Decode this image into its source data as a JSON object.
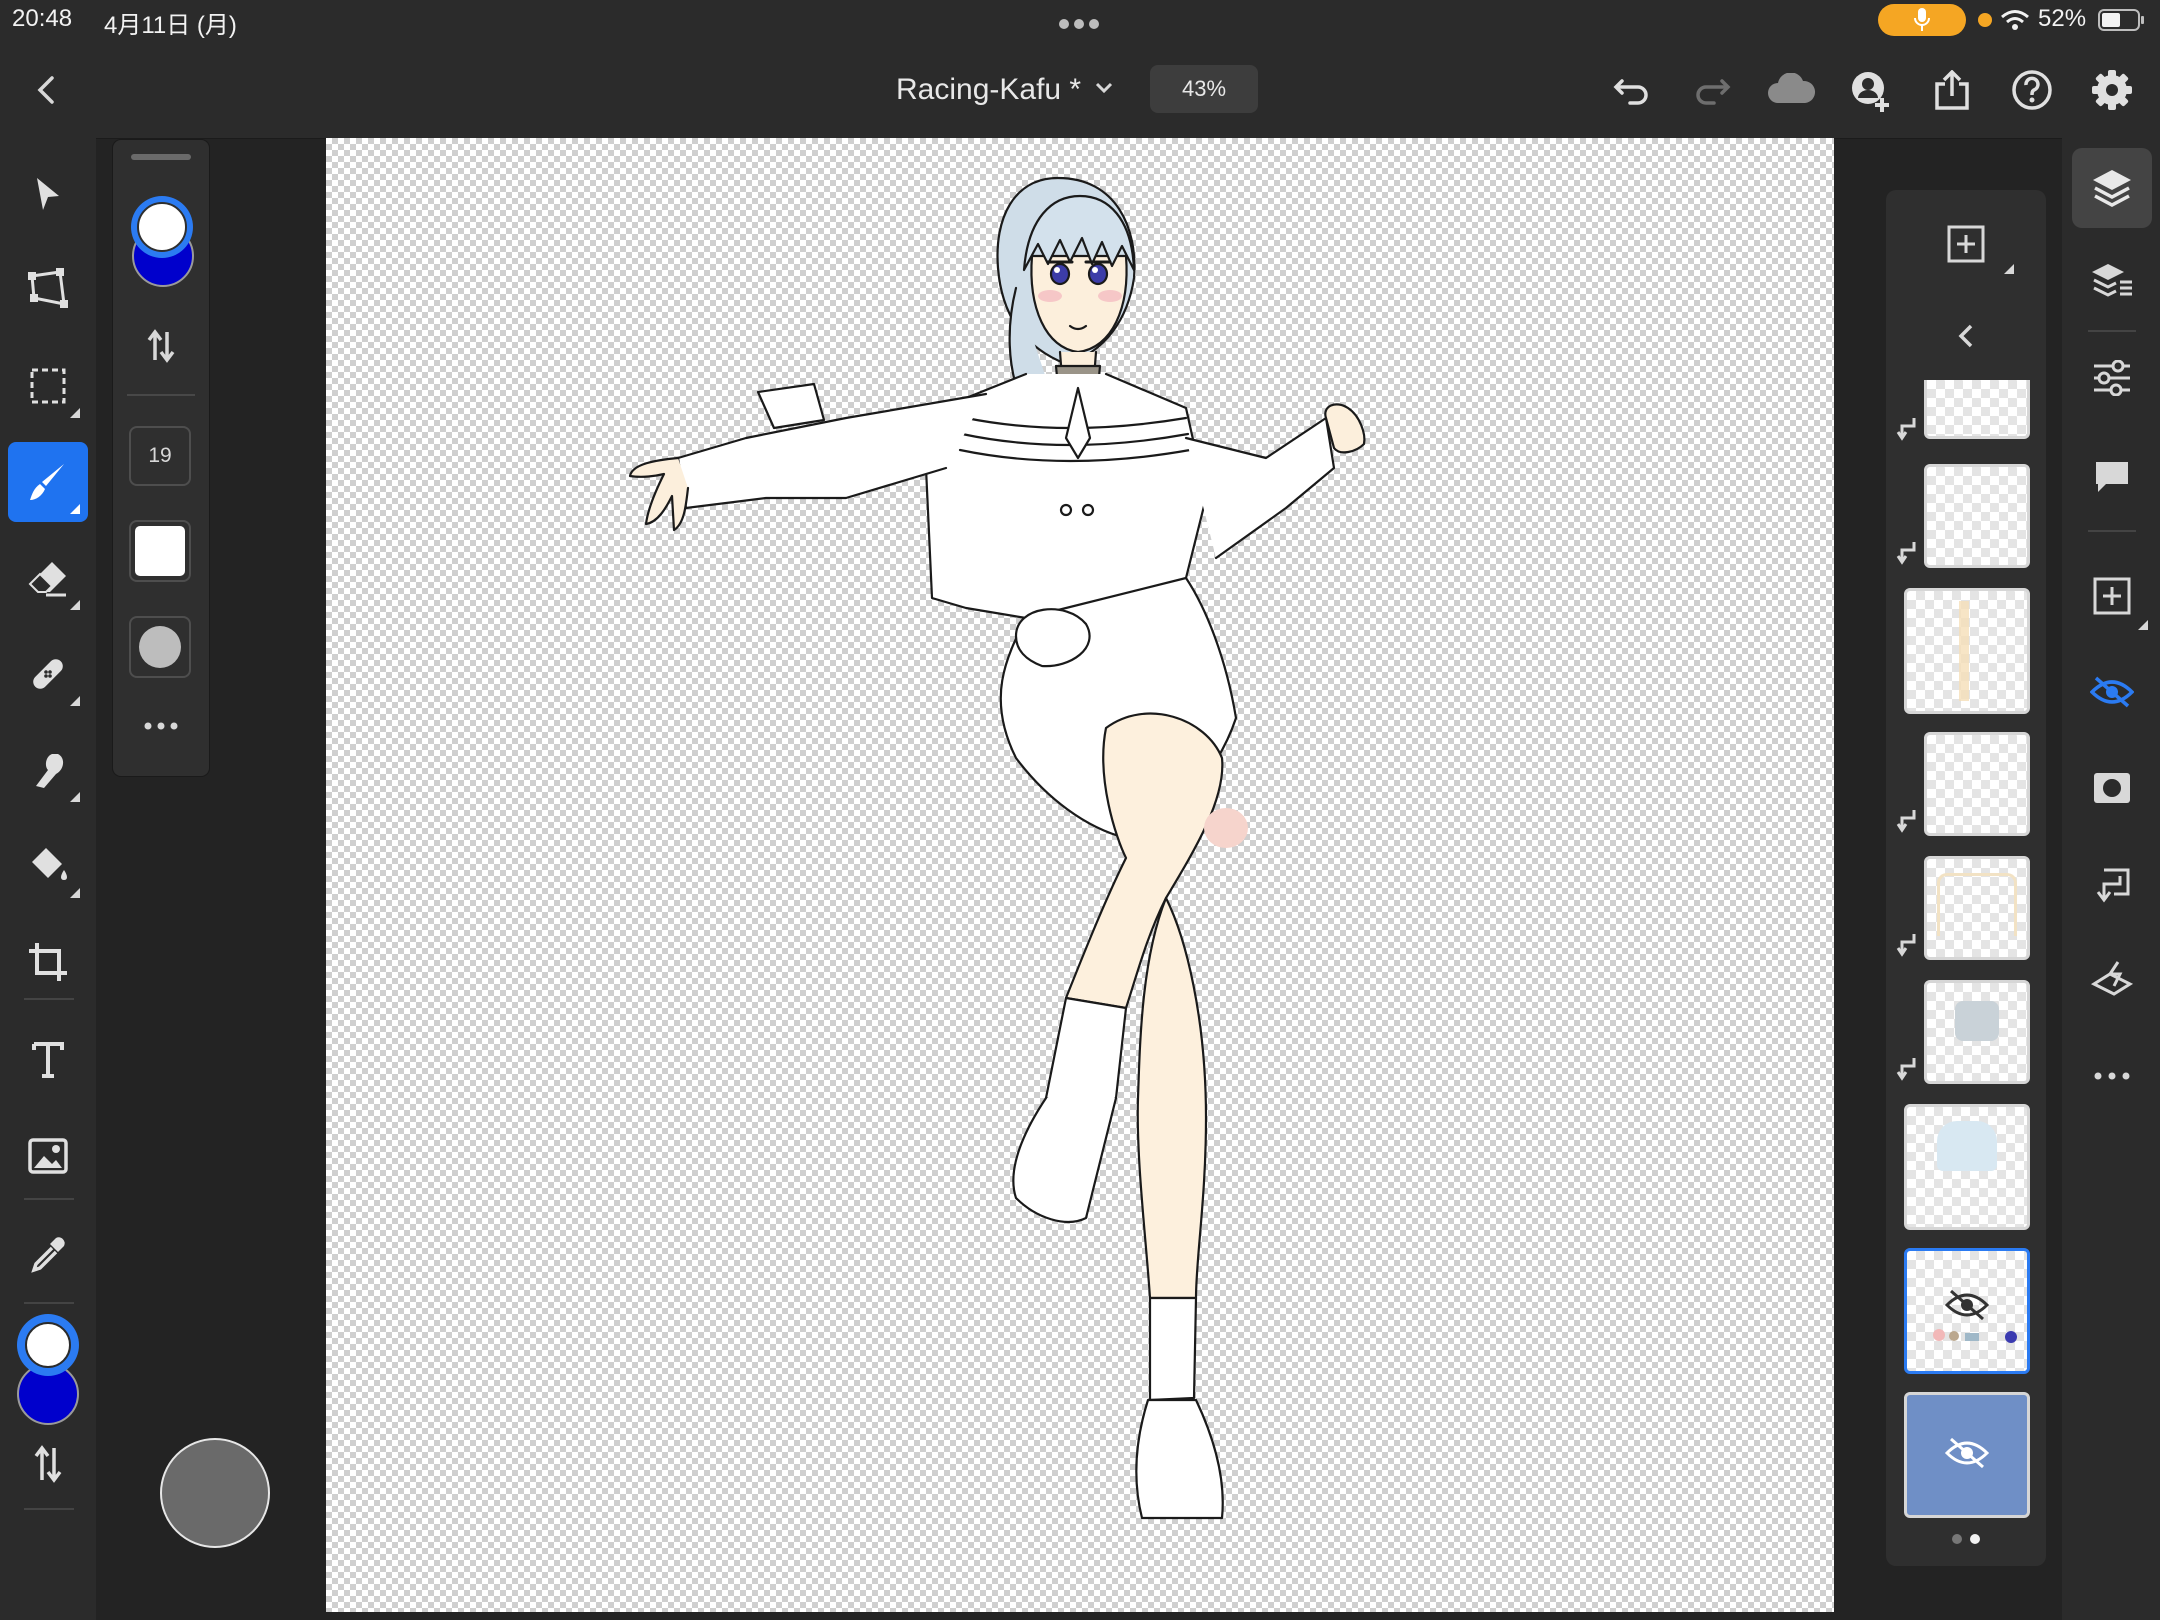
{
  "status": {
    "time": "20:48",
    "date": "4月11日 (月)",
    "battery": "52%",
    "battery_level": 0.52
  },
  "document": {
    "title": "Racing-Kafu *",
    "zoom": "43%"
  },
  "props": {
    "brush_size": "19"
  },
  "colors": {
    "primary": "#ffffff",
    "secondary": "#0000cc",
    "accent": "#2b7bf2",
    "mic_pill": "#f5a623"
  },
  "toolbar": {
    "tools": [
      "select-tool",
      "transform-tool",
      "marquee-tool",
      "brush-tool",
      "eraser-tool",
      "healing-tool",
      "smudge-tool",
      "fill-tool",
      "crop-tool",
      "text-tool",
      "image-tool",
      "eyedropper-tool"
    ],
    "active_tool": "brush-tool"
  },
  "layers": {
    "count": 9,
    "selected_index": 7,
    "pager": {
      "pages": 2,
      "current": 2
    }
  }
}
